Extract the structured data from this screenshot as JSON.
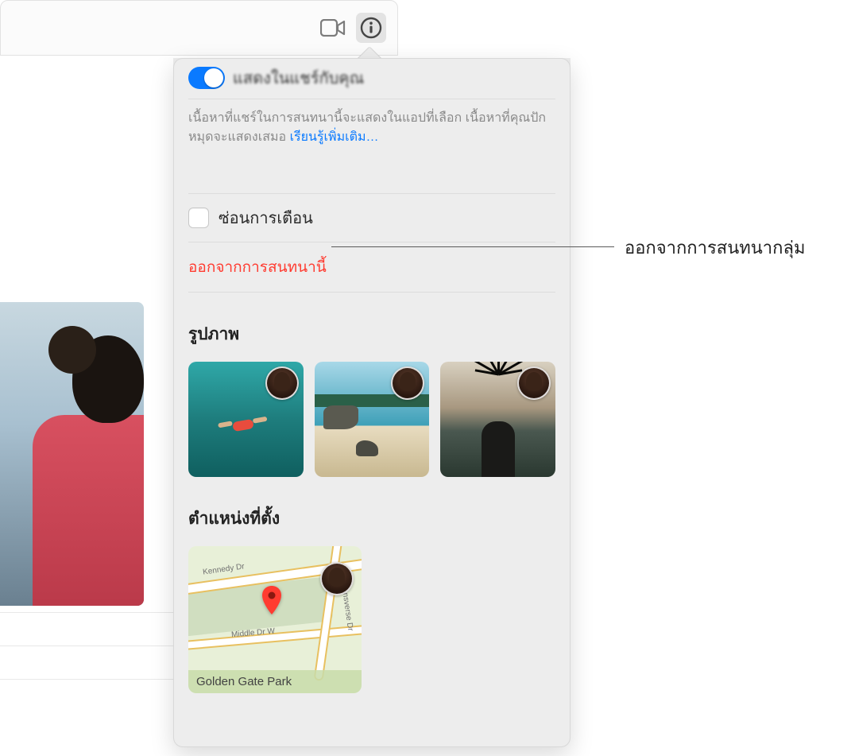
{
  "share": {
    "label": "แสดงในแชร์กับคุณ",
    "desc_part1": "เนื้อหาที่แชร์ในการสนทนานี้จะแสดงในแอปที่เลือก เนื้อหาที่คุณปักหมุดจะแสดงเสมอ ",
    "learn_more": "เรียนรู้เพิ่มเติม…"
  },
  "hide_alerts_label": "ซ่อนการเตือน",
  "leave_label": "ออกจากการสนทนานี้",
  "photos_title": "รูปภาพ",
  "location_title": "ตำแหน่งที่ตั้ง",
  "map": {
    "road1": "Kennedy Dr",
    "road2": "Middle Dr W",
    "road3": "Transverse Dr",
    "caption": "Golden Gate Park"
  },
  "callout": "ออกจากการสนทนากลุ่ม"
}
